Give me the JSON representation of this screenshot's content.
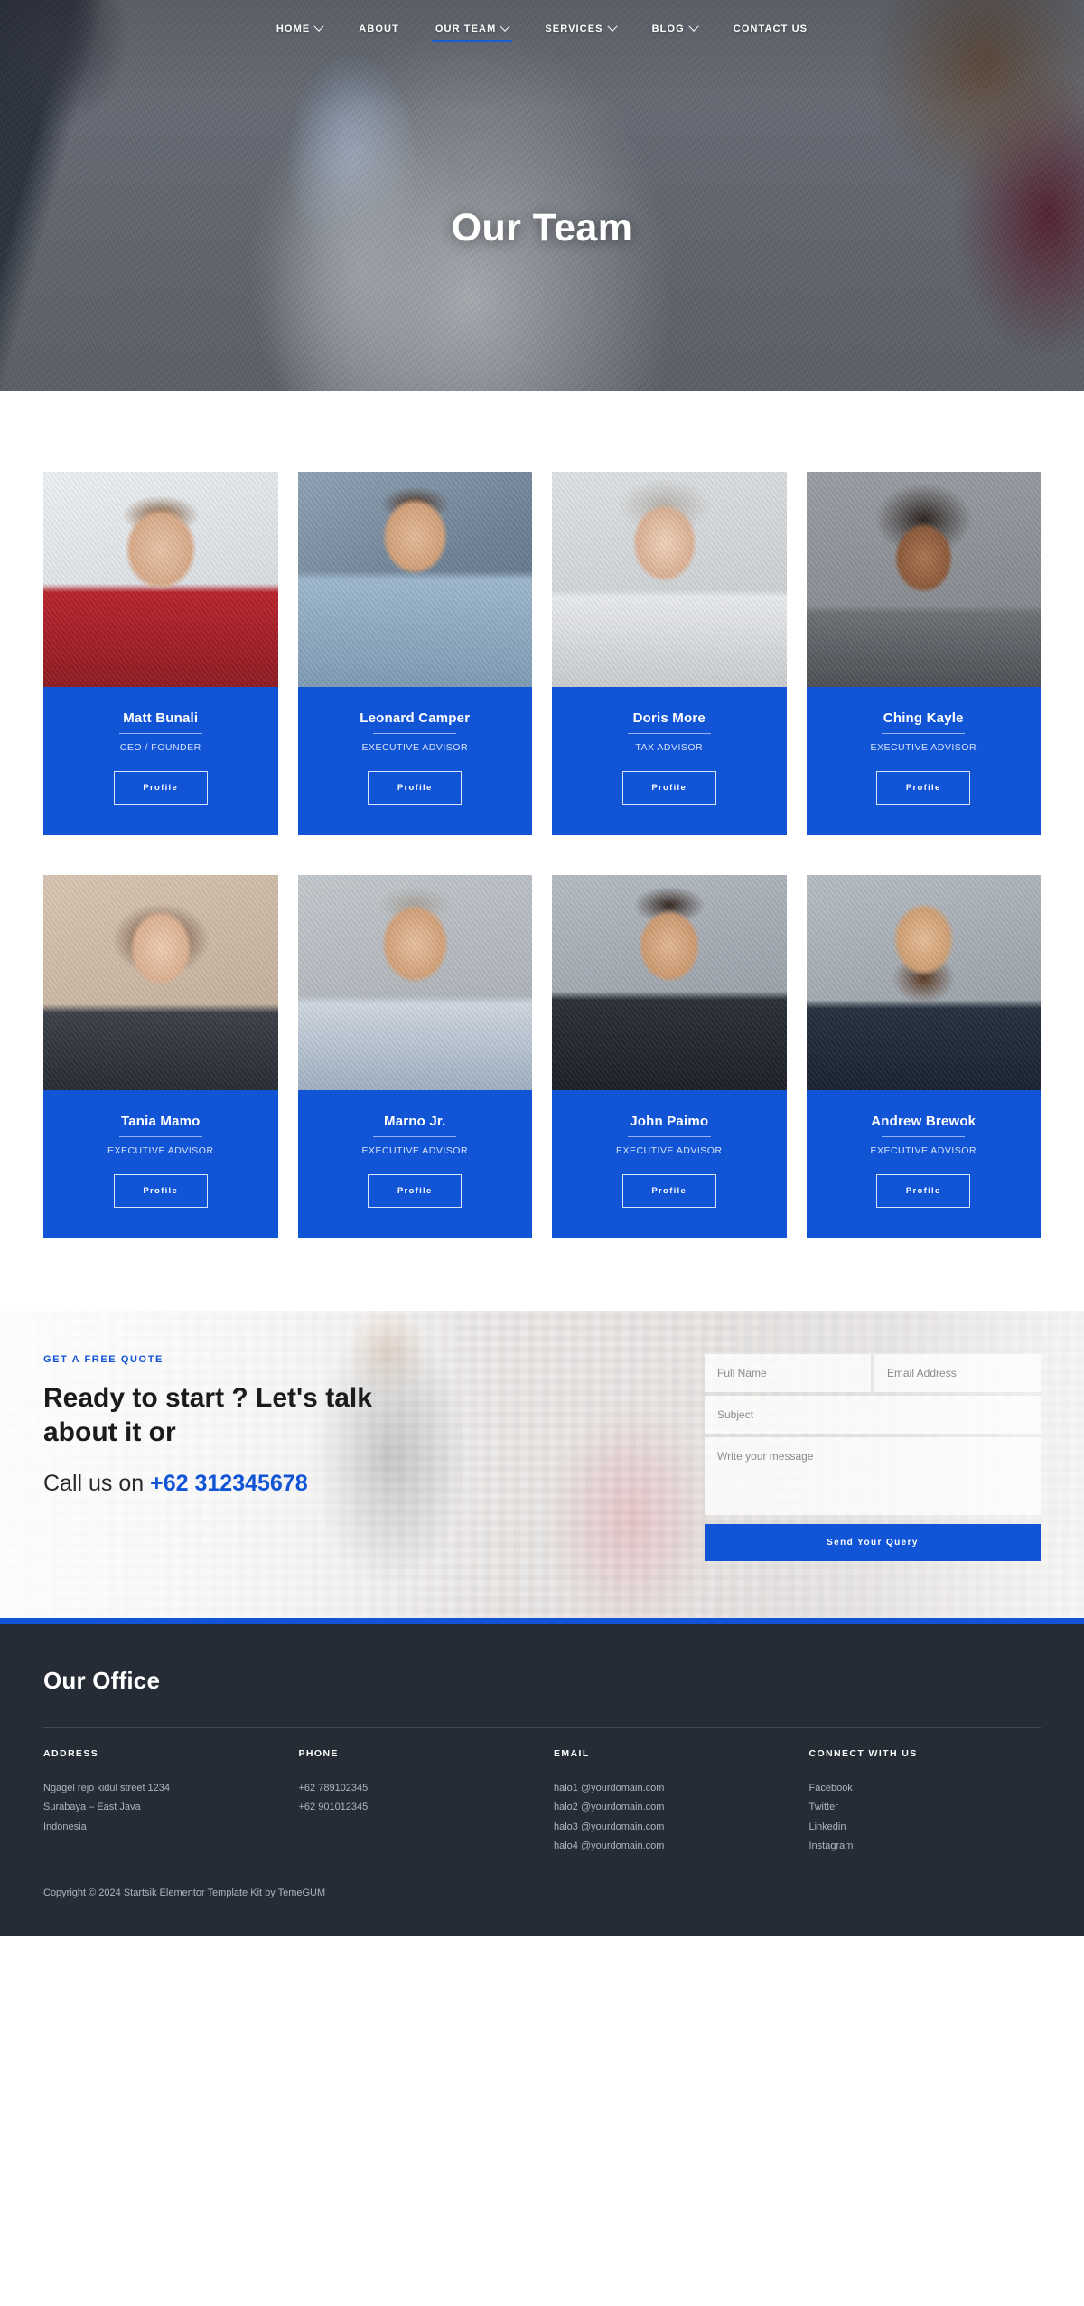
{
  "nav": {
    "items": [
      {
        "label": "HOME",
        "caret": true,
        "active": false
      },
      {
        "label": "ABOUT",
        "caret": false,
        "active": false
      },
      {
        "label": "OUR TEAM",
        "caret": true,
        "active": true
      },
      {
        "label": "SERVICES",
        "caret": true,
        "active": false
      },
      {
        "label": "BLOG",
        "caret": true,
        "active": false
      },
      {
        "label": "CONTACT US",
        "caret": false,
        "active": false
      }
    ]
  },
  "hero": {
    "title": "Our Team"
  },
  "team": {
    "button_label": "Profile",
    "card_bg": "#1154d6",
    "members": [
      {
        "name": "Matt Bunali",
        "role": "CEO / FOUNDER",
        "photo": "p1"
      },
      {
        "name": "Leonard Camper",
        "role": "EXECUTIVE ADVISOR",
        "photo": "p2"
      },
      {
        "name": "Doris More",
        "role": "TAX ADVISOR",
        "photo": "p3"
      },
      {
        "name": "Ching Kayle",
        "role": "EXECUTIVE ADVISOR",
        "photo": "p4"
      },
      {
        "name": "Tania Mamo",
        "role": "EXECUTIVE ADVISOR",
        "photo": "p5"
      },
      {
        "name": "Marno Jr.",
        "role": "EXECUTIVE ADVISOR",
        "photo": "p6"
      },
      {
        "name": "John Paimo",
        "role": "EXECUTIVE ADVISOR",
        "photo": "p7"
      },
      {
        "name": "Andrew Brewok",
        "role": "EXECUTIVE ADVISOR",
        "photo": "p8"
      }
    ]
  },
  "cta": {
    "eyebrow": "GET A FREE QUOTE",
    "heading": "Ready to start ? Let's talk about it or",
    "call_prefix": "Call us on ",
    "phone": "+62 312345678",
    "accent": "#1154d6",
    "form": {
      "full_name_placeholder": "Full Name",
      "email_placeholder": "Email Address",
      "subject_placeholder": "Subject",
      "message_placeholder": "Write your message",
      "submit_label": "Send Your Query"
    }
  },
  "footer": {
    "title": "Our Office",
    "columns": [
      {
        "head": "ADDRESS",
        "lines": [
          "Ngagel rejo kidul street 1234",
          "Surabaya – East Java",
          "Indonesia"
        ]
      },
      {
        "head": "PHONE",
        "lines": [
          "+62 789102345",
          "+62 901012345"
        ]
      },
      {
        "head": "EMAIL",
        "lines": [
          "halo1 @yourdomain.com",
          "halo2 @yourdomain.com",
          "halo3 @yourdomain.com",
          "halo4 @yourdomain.com"
        ]
      },
      {
        "head": "CONNECT WITH US",
        "lines": [
          "Facebook",
          "Twitter",
          "Linkedin",
          "Instagram"
        ]
      }
    ],
    "copyright": "Copyright © 2024 Startsik Elementor Template Kit by TemeGUM"
  }
}
